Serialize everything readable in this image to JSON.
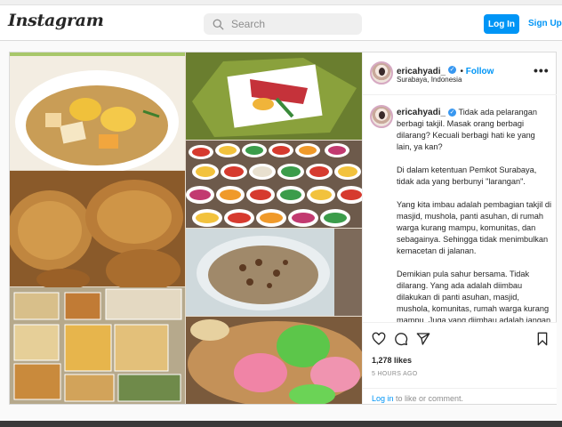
{
  "nav": {
    "logo": "Instagram",
    "search_placeholder": "Search",
    "login_label": "Log In",
    "signup_label": "Sign Up"
  },
  "post": {
    "username": "ericahyadi_",
    "follow_label": "Follow",
    "location": "Surabaya, Indonesia",
    "caption_first": "Tidak ada pelarangan berbagi takjil. Masak orang berbagi dilarang? Kecuali berbagi hati ke yang lain, ya kan?",
    "paragraphs": [
      "Di dalam ketentuan Pemkot Surabaya, tidak ada yang berbunyi \"larangan\".",
      "Yang kita imbau adalah pembagian takjil di masjid, mushola, panti asuhan, di rumah warga kurang mampu, komunitas, dan sebagainya. Sehingga tidak menimbulkan kemacetan di jalanan.",
      "Demikian pula sahur bersama. Tidak dilarang. Yang ada adalah diimbau dilakukan di panti asuhan, masjid, mushola, komunitas, rumah warga kurang mampu. Juga yang diimbau adalah jangan bagi sahur sambil trek-"
    ],
    "likes": "1,278 likes",
    "time": "5 HOURS AGO",
    "login_link": "Log in",
    "login_rest": " to like or comment."
  },
  "colors": {
    "accent": "#0095f6",
    "verified": "#3897f0"
  },
  "icons": [
    "search-icon",
    "verified-icon",
    "more-icon",
    "heart-icon",
    "comment-icon",
    "share-icon",
    "bookmark-icon"
  ]
}
